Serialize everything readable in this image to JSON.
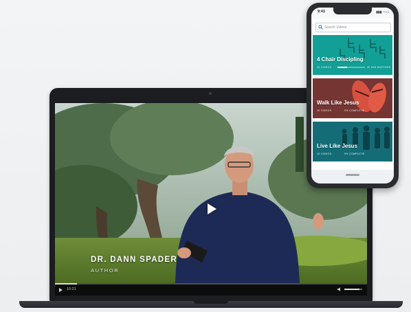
{
  "laptop": {
    "video": {
      "speaker_name": "DR. DANN SPADER",
      "speaker_role": "AUTHOR",
      "time": "10:21",
      "progress": 0.07,
      "volume": 0.85
    }
  },
  "phone": {
    "status": {
      "time": "9:41",
      "icons": "▮▮▮ ◔ ▭"
    },
    "search": {
      "placeholder": "Search Videos"
    },
    "cards": [
      {
        "title": "4 Chair Discipling",
        "meta_left": "10 VIDEOS",
        "meta_right": "40 MIN WATCHED",
        "progress": 0.35,
        "color": "#13a89e"
      },
      {
        "title": "Walk Like Jesus",
        "meta_left": "10 VIDEOS",
        "meta_right": "0% COMPLETE",
        "progress": 0.0,
        "color": "#c8443a"
      },
      {
        "title": "Live Like Jesus",
        "meta_left": "10 VIDEOS",
        "meta_right": "0% COMPLETE",
        "progress": 0.0,
        "color": "#1a7f86"
      }
    ]
  },
  "colors": {
    "background": "#eef0f2",
    "laptop_body": "#1b1d20",
    "teal": "#13a89e",
    "red": "#c8443a"
  }
}
